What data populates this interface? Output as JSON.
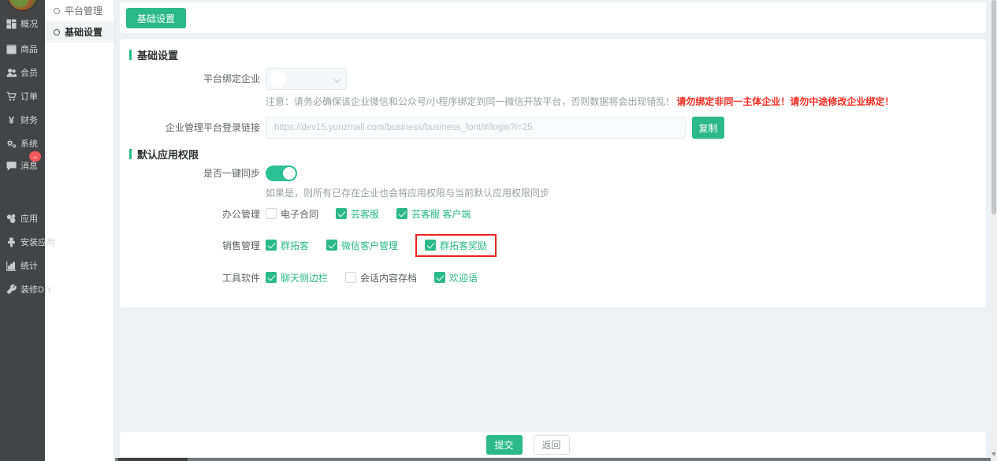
{
  "sidebar": {
    "items": [
      {
        "label": "概况",
        "icon": "overview-icon"
      },
      {
        "label": "商品",
        "icon": "product-icon"
      },
      {
        "label": "会员",
        "icon": "members-icon"
      },
      {
        "label": "订单",
        "icon": "orders-icon"
      },
      {
        "label": "财务",
        "icon": "finance-icon"
      },
      {
        "label": "系统",
        "icon": "system-icon"
      },
      {
        "label": "消息",
        "icon": "message-icon",
        "badge": "–"
      },
      {
        "label": "应用",
        "icon": "apps-icon"
      },
      {
        "label": "安装应用",
        "icon": "install-app-icon"
      },
      {
        "label": "统计",
        "icon": "stats-icon"
      },
      {
        "label": "装修DIY",
        "icon": "diy-icon"
      }
    ]
  },
  "submenu": {
    "items": [
      {
        "label": "平台管理",
        "active": false
      },
      {
        "label": "基础设置",
        "active": true
      }
    ]
  },
  "toolbar": {
    "basic_tab_label": "基础设置"
  },
  "basic_section": {
    "title": "基础设置",
    "bind_company_label": "平台绑定企业",
    "note_gray": "注意：请务必确保该企业微信和公众号/小程序绑定到同一微信开放平台，否则数据将会出现错乱！",
    "note_red": "请勿绑定非同一主体企业！请勿中途修改企业绑定！",
    "login_link_label": "企业管理平台登录链接",
    "login_link_value": "https://dev15.yunzmall.com/business/business_font/#/login?i=25",
    "copy_label": "复制"
  },
  "permission_section": {
    "title": "默认应用权限",
    "sync_label": "是否一键同步",
    "sync_on": true,
    "sync_help": "如果是，则所有已存在企业也会将应用权限与当前默认应用权限同步",
    "groups": [
      {
        "label": "办公管理",
        "items": [
          {
            "label": "电子合同",
            "checked": false
          },
          {
            "label": "芸客服",
            "checked": true
          },
          {
            "label": "芸客服 客户端",
            "checked": true
          }
        ]
      },
      {
        "label": "销售管理",
        "items": [
          {
            "label": "群拓客",
            "checked": true
          },
          {
            "label": "微信客户管理",
            "checked": true
          },
          {
            "label": "群拓客奖励",
            "checked": true,
            "highlighted": true
          }
        ]
      },
      {
        "label": "工具软件",
        "items": [
          {
            "label": "聊天侧边栏",
            "checked": true
          },
          {
            "label": "会话内容存档",
            "checked": false
          },
          {
            "label": "欢迎语",
            "checked": true
          }
        ]
      }
    ]
  },
  "footer": {
    "submit_label": "提交",
    "back_label": "返回"
  },
  "colors": {
    "accent": "#2bb98a",
    "warning_red": "#f52b21",
    "highlight_box_red": "#ee2222",
    "badge_red": "#f25a5a",
    "sidebar_dark": "#424446"
  }
}
